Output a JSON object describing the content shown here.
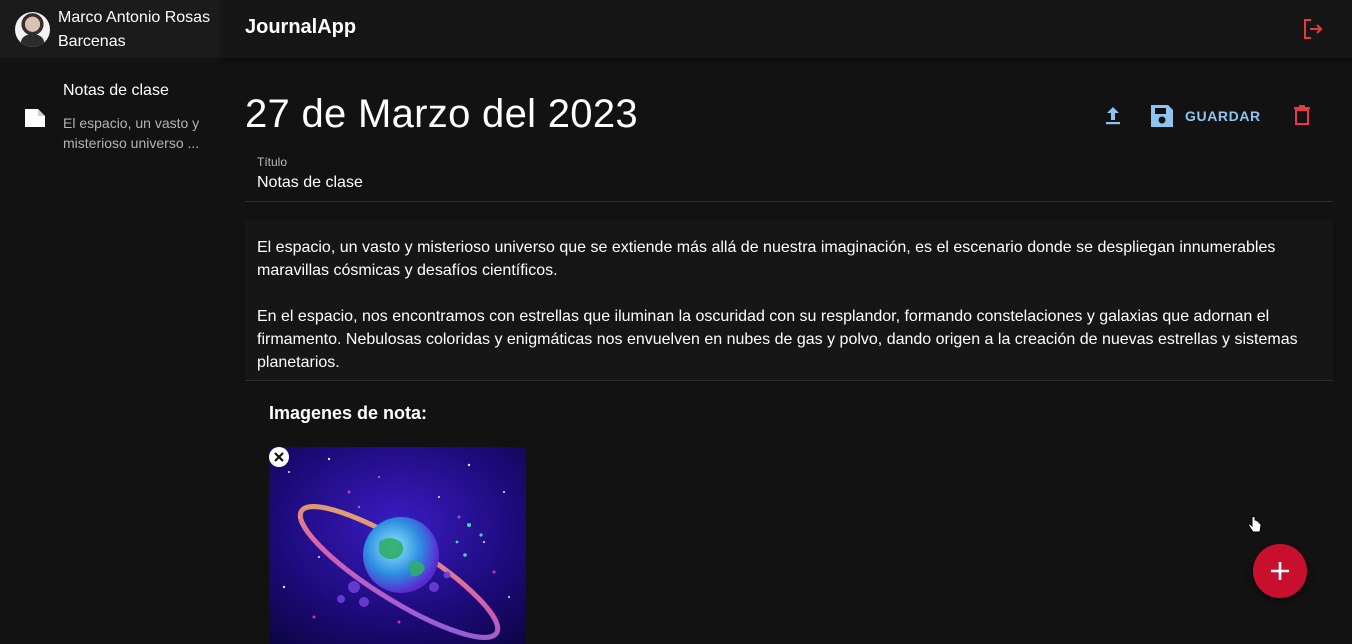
{
  "sidebar": {
    "user_name": "Marco Antonio Rosas Barcenas",
    "notes": [
      {
        "title": "Notas de clase",
        "excerpt": "El espacio, un vasto y misterioso universo ..."
      }
    ]
  },
  "header": {
    "app_title": "JournalApp"
  },
  "note": {
    "date": "27 de Marzo del 2023",
    "save_label": "GUARDAR",
    "title_label": "Título",
    "title_value": "Notas de clase",
    "body": "El espacio, un vasto y misterioso universo que se extiende más allá de nuestra imaginación, es el escenario donde se despliegan innumerables maravillas cósmicas y desafíos científicos.\n\nEn el espacio, nos encontramos con estrellas que iluminan la oscuridad con su resplandor, formando constelaciones y galaxias que adornan el firmamento. Nebulosas coloridas y enigmáticas nos envuelven en nubes de gas y polvo, dando origen a la creación de nuevas estrellas y sistemas planetarios.",
    "images_heading": "Imagenes de nota:"
  },
  "icons": {
    "logout": "logout-icon",
    "upload": "upload-icon",
    "save": "save-icon",
    "delete": "trash-icon",
    "note": "note-icon",
    "add": "plus-icon",
    "remove_image": "close-icon",
    "cursor": "hand-cursor-icon"
  },
  "colors": {
    "background": "#121212",
    "accent_blue": "#8fc4f0",
    "accent_red": "#c8102e",
    "danger": "#e53945"
  }
}
